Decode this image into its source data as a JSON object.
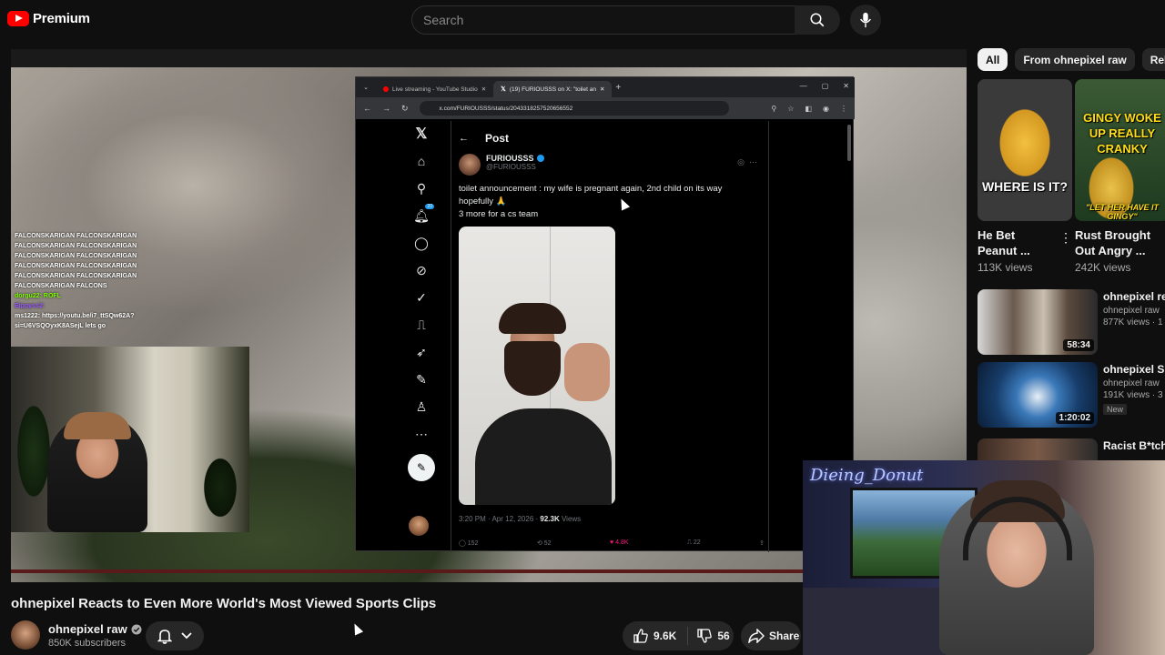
{
  "header": {
    "brand": "Premium",
    "search_placeholder": "Search"
  },
  "player": {
    "chat_lines": [
      {
        "text": "FALCONSKARIGAN FALCONSKARIGAN"
      },
      {
        "text": "FALCONSKARIGAN FALCONSKARIGAN"
      },
      {
        "text": "FALCONSKARIGAN FALCONSKARIGAN"
      },
      {
        "text": "FALCONSKARIGAN FALCONSKARIGAN"
      },
      {
        "text": "FALCONSKARIGAN FALCONSKARIGAN"
      },
      {
        "text": "FALCONSKARIGAN FALCONS"
      },
      {
        "text": "dorgu22: ROFL"
      },
      {
        "text": "Eippyss2:"
      },
      {
        "text": "ms1222: https://youtu.be/i7_ttSQw62A?"
      },
      {
        "text": "si=U6VSQOyxK8ASejL lets go"
      }
    ],
    "browser": {
      "tab1": "Live streaming - YouTube Studio",
      "tab2": "(19) FURIOUSSS on X: \"toilet an",
      "url": "x.com/FURIOUSSS/status/2043318257520656552",
      "post": {
        "header": "Post",
        "author": "FURIOUSSS",
        "handle": "@FURIOUSSS",
        "text_line1": "toilet announcement : my wife is pregnant again, 2nd child on its way",
        "text_line2": "hopefully 🙏",
        "text_line3": "3 more for a cs team",
        "meta_time": "3:20 PM · Apr 12, 2026 · ",
        "meta_views": "92.3K",
        "meta_views_label": " Views",
        "replies": "152",
        "reposts": "52",
        "likes": "4.8K",
        "bookmarks": "22"
      },
      "notification_count": "20"
    }
  },
  "video": {
    "title": "ohnepixel Reacts to Even More World's Most Viewed Sports Clips",
    "channel": "ohnepixel raw",
    "subscribers": "850K subscribers",
    "likes": "9.6K",
    "dislikes": "56",
    "share_label": "Share"
  },
  "sidebar": {
    "chips": [
      "All",
      "From ohnepixel raw",
      "Related"
    ],
    "shorts": [
      {
        "title": "He Bet Peanut ...",
        "views": "113K views",
        "caption": "WHERE IS IT?"
      },
      {
        "title": "Rust Brought Out Angry ...",
        "views": "242K views",
        "caption_top": "GINGY WOKE UP REALLY CRANKY",
        "caption_bottom": "\"LET HER HAVE IT GINGY\""
      }
    ],
    "recommended": [
      {
        "title": "ohnepixel reacts Most Viewed",
        "channel": "ohnepixel raw",
        "meta": "877K views · 1",
        "duration": "58:34"
      },
      {
        "title": "ohnepixel Shows ULTIMATE Im",
        "channel": "ohnepixel raw",
        "meta": "191K views · 3",
        "duration": "1:20:02",
        "badge": "New"
      },
      {
        "title": "Racist B*tch H Name | Finan",
        "channel": "",
        "meta": "",
        "duration": ""
      }
    ]
  },
  "overlay": {
    "streamer_name": "Dieing_Donut"
  }
}
